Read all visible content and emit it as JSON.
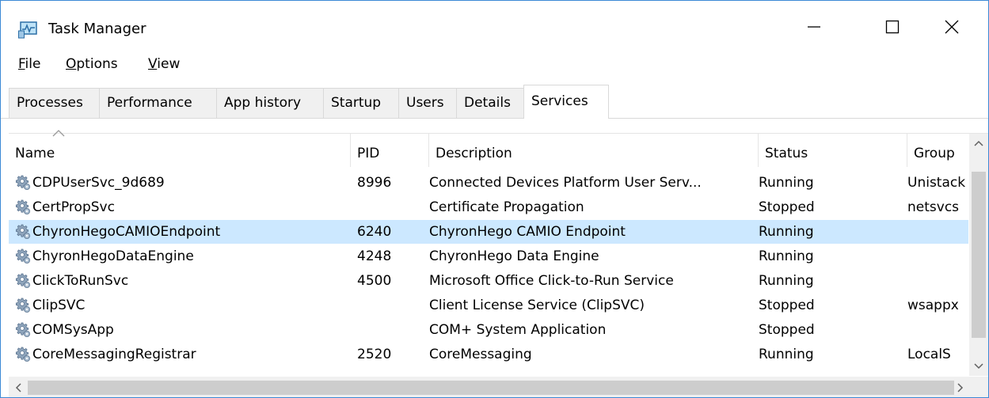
{
  "window": {
    "title": "Task Manager"
  },
  "menu": {
    "file": "File",
    "options": "Options",
    "view": "View"
  },
  "tabs": [
    "Processes",
    "Performance",
    "App history",
    "Startup",
    "Users",
    "Details",
    "Services"
  ],
  "active_tab": "Services",
  "columns": {
    "name": "Name",
    "pid": "PID",
    "description": "Description",
    "status": "Status",
    "group": "Group"
  },
  "rows": [
    {
      "name": "CDPUserSvc_9d689",
      "pid": "8996",
      "description": "Connected Devices Platform User Serv...",
      "status": "Running",
      "group": "Unistack"
    },
    {
      "name": "CertPropSvc",
      "pid": "",
      "description": "Certificate Propagation",
      "status": "Stopped",
      "group": "netsvcs"
    },
    {
      "name": "ChyronHegoCAMIOEndpoint",
      "pid": "6240",
      "description": "ChyronHego CAMIO Endpoint",
      "status": "Running",
      "group": "",
      "selected": true
    },
    {
      "name": "ChyronHegoDataEngine",
      "pid": "4248",
      "description": "ChyronHego Data Engine",
      "status": "Running",
      "group": ""
    },
    {
      "name": "ClickToRunSvc",
      "pid": "4500",
      "description": "Microsoft Office Click-to-Run Service",
      "status": "Running",
      "group": ""
    },
    {
      "name": "ClipSVC",
      "pid": "",
      "description": "Client License Service (ClipSVC)",
      "status": "Stopped",
      "group": "wsappx"
    },
    {
      "name": "COMSysApp",
      "pid": "",
      "description": "COM+ System Application",
      "status": "Stopped",
      "group": ""
    },
    {
      "name": "CoreMessagingRegistrar",
      "pid": "2520",
      "description": "CoreMessaging",
      "status": "Running",
      "group": "LocalS"
    }
  ],
  "colors": {
    "selection": "#cce8ff",
    "scrollbar_track": "#f0f0f0",
    "scrollbar_thumb": "#cdcdcd",
    "window_border": "#3c8ad6"
  }
}
